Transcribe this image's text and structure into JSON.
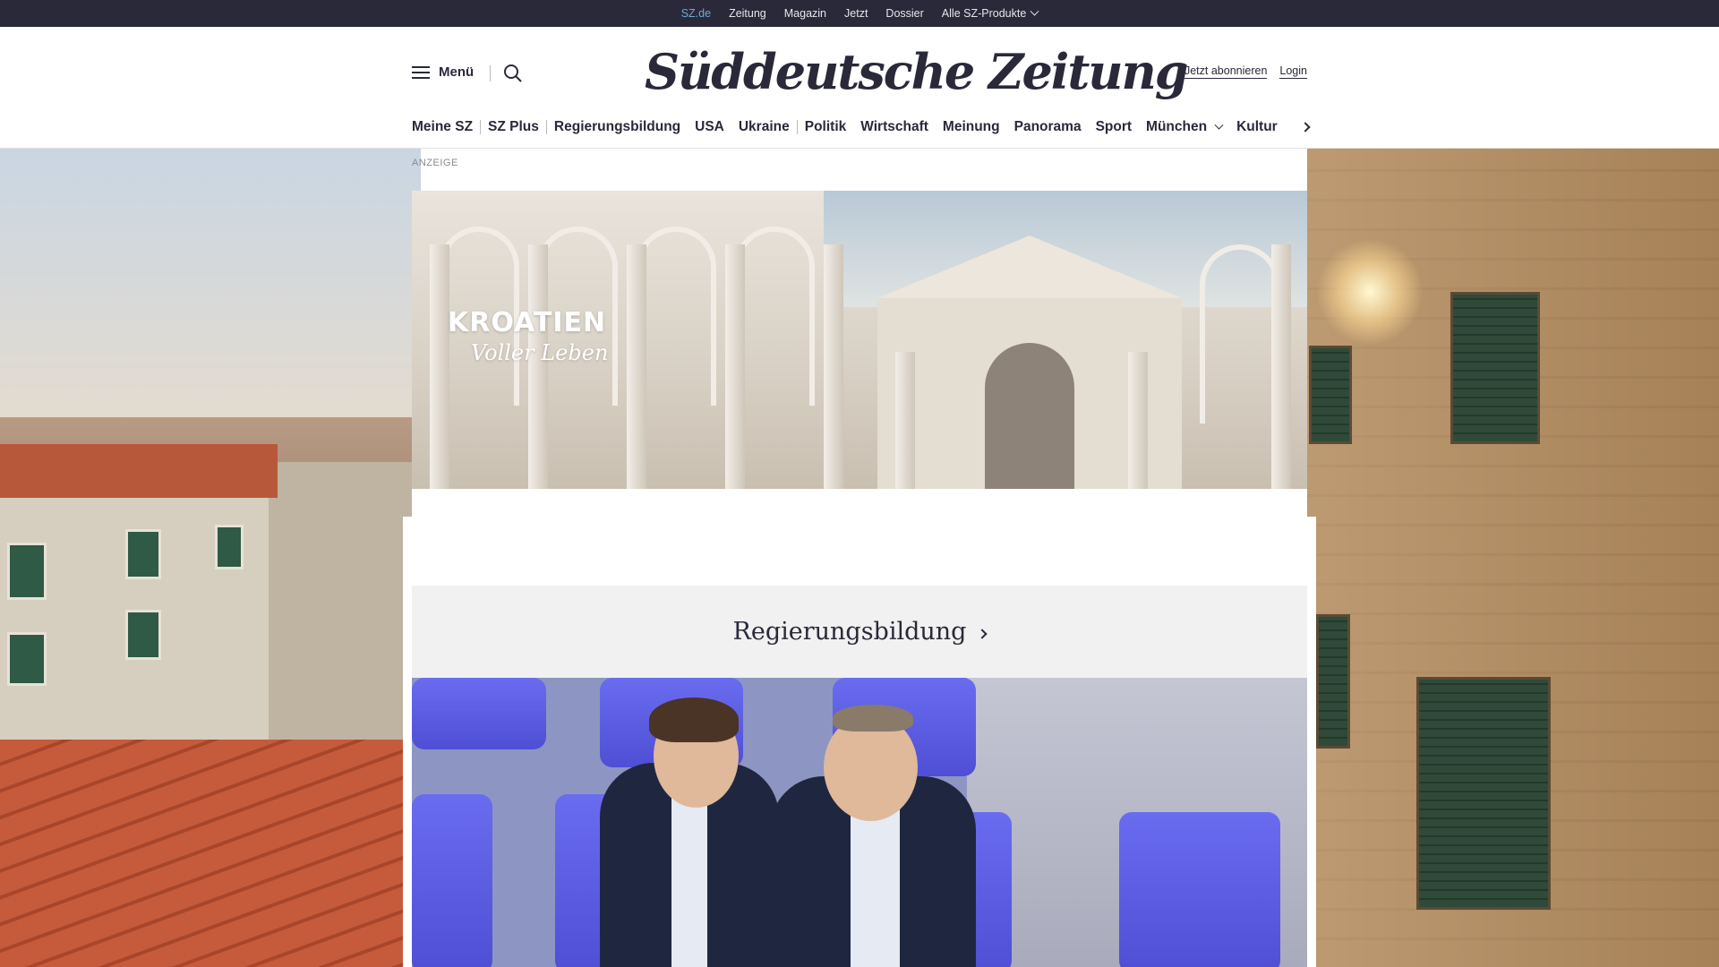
{
  "topbar": {
    "items": [
      "SZ.de",
      "Zeitung",
      "Magazin",
      "Jetzt",
      "Dossier",
      "Alle SZ-Produkte"
    ],
    "active_color": "#6ea9d6",
    "background": "#29293a"
  },
  "header": {
    "menu_label": "Menü",
    "logo": "Süddeutsche Zeitung",
    "subscribe_label": "Jetzt abonnieren",
    "login_label": "Login"
  },
  "section_nav": {
    "items": [
      "Meine SZ",
      "SZ Plus",
      "Regierungsbildung",
      "USA",
      "Ukraine",
      "Politik",
      "Wirtschaft",
      "Meinung",
      "Panorama",
      "Sport",
      "München",
      "Kultur"
    ]
  },
  "ad": {
    "label": "ANZEIGE",
    "brand_line1": "KROATIEN",
    "brand_line2": "Voller Leben"
  },
  "section_teaser": {
    "title": "Regierungsbildung"
  },
  "icons": {
    "menu": "hamburger-icon",
    "search": "search-icon",
    "dropdown": "chevron-down-icon",
    "more": "chevron-right-icon"
  }
}
